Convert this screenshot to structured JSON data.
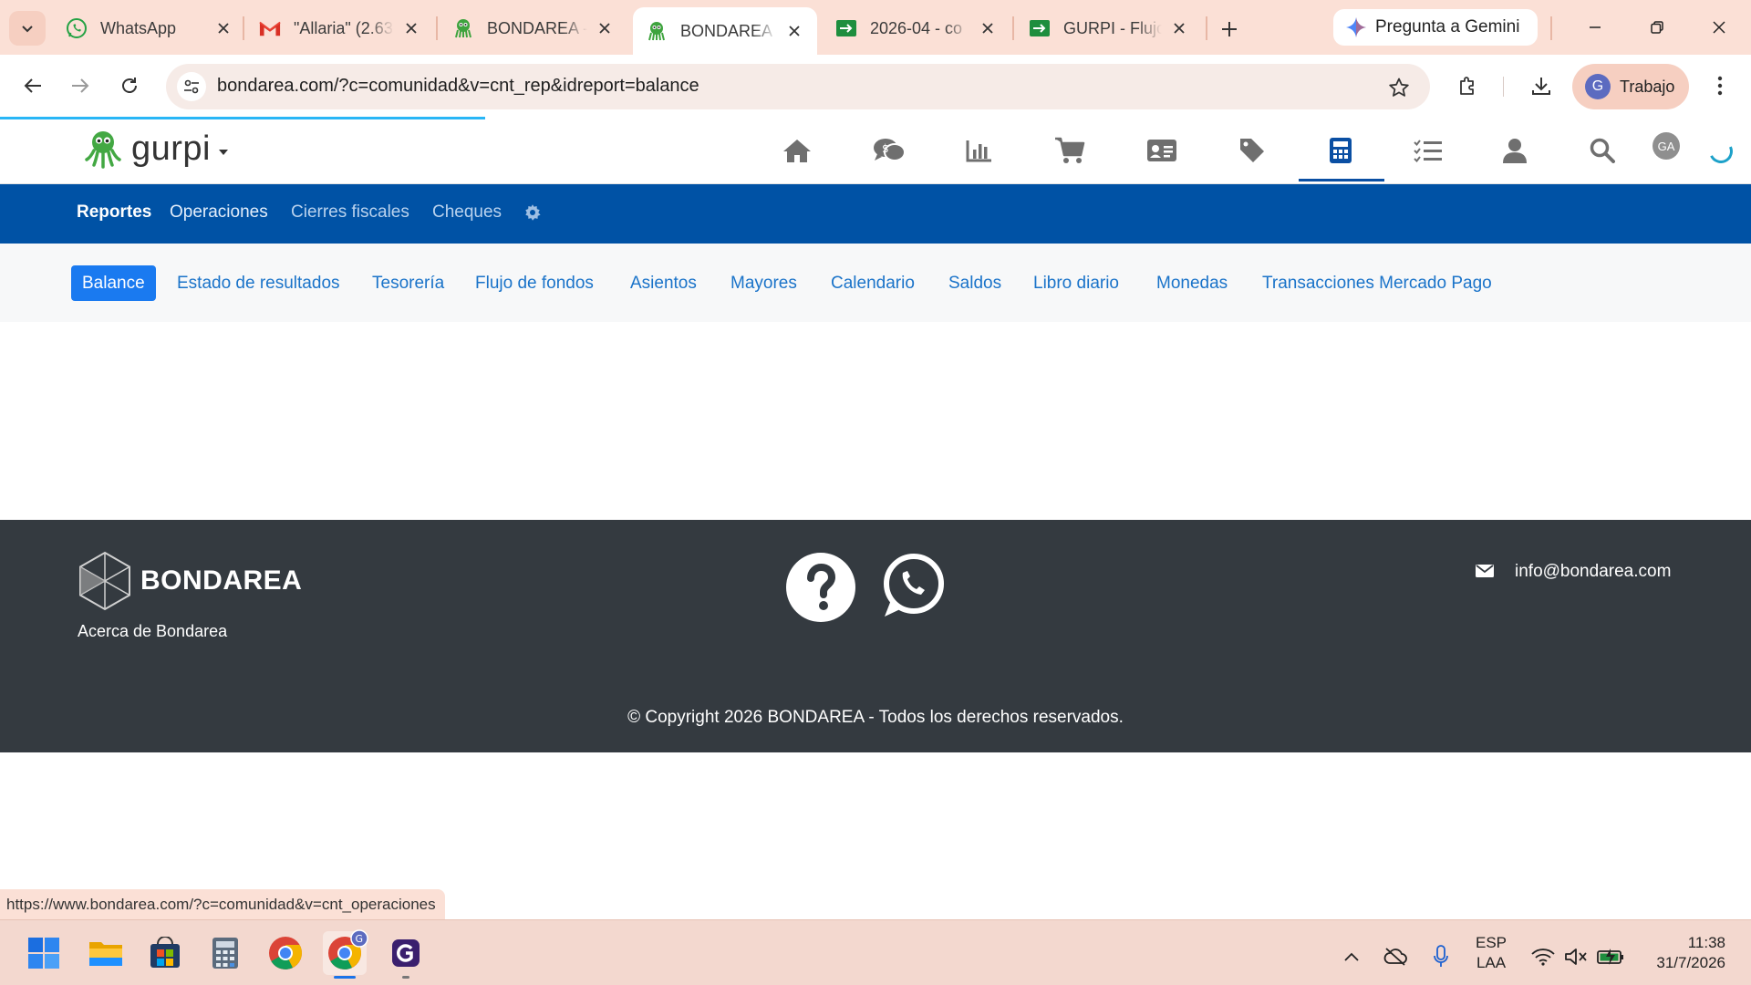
{
  "browser": {
    "tabs": [
      {
        "title": "WhatsApp",
        "icon": "whatsapp-icon",
        "active": false
      },
      {
        "title": "\"Allaria\" (2.63",
        "icon": "gmail-icon",
        "active": false
      },
      {
        "title": "BONDAREA -",
        "icon": "gurpi-octopus-icon",
        "active": false
      },
      {
        "title": "BONDAREA -",
        "icon": "gurpi-octopus-icon",
        "active": true
      },
      {
        "title": "2026-04 - co",
        "icon": "sheets-icon",
        "active": false
      },
      {
        "title": "GURPI - Flujo",
        "icon": "sheets-icon",
        "active": false
      }
    ],
    "gemini_label": "Pregunta a Gemini",
    "url": "bondarea.com/?c=comunidad&v=cnt_rep&idreport=balance",
    "profile_initial": "G",
    "profile_name": "Trabajo"
  },
  "app": {
    "brand": "gurpi",
    "header_icons": [
      "home-icon",
      "chat-money-icon",
      "bar-chart-icon",
      "cart-icon",
      "id-card-icon",
      "tag-icon",
      "calculator-icon",
      "checklist-icon",
      "user-icon",
      "search-icon"
    ],
    "active_header_icon": "calculator-icon",
    "user_initials": "GA",
    "module_nav": [
      "Reportes",
      "Operaciones",
      "Cierres fiscales",
      "Cheques"
    ],
    "active_module": "Reportes",
    "report_tabs": [
      "Balance",
      "Estado de resultados",
      "Tesorería",
      "Flujo de fondos",
      "Asientos",
      "Mayores",
      "Calendario",
      "Saldos",
      "Libro diario",
      "Monedas",
      "Transacciones Mercado Pago"
    ],
    "active_report": "Balance"
  },
  "footer": {
    "brand": "BONDAREA",
    "about": "Acerca de Bondarea",
    "email": "info@bondarea.com",
    "copyright": "© Copyright 2026 BONDAREA - Todos los derechos reservados."
  },
  "status_url": "https://www.bondarea.com/?c=comunidad&v=cnt_operaciones",
  "taskbar": {
    "apps": [
      "windows-start-icon",
      "file-explorer-icon",
      "ms-store-icon",
      "calculator-app-icon",
      "chrome-icon",
      "chrome-profile-icon",
      "app-g-icon"
    ],
    "language_top": "ESP",
    "language_bottom": "LAA",
    "time": "11:38",
    "date": "31/7/2026"
  },
  "colors": {
    "chrome_tab_strip": "#fbe0d6",
    "app_nav_blue": "#0052a5",
    "report_active": "#1a7af0",
    "footer_bg": "#343a40",
    "link": "#1a73c9"
  }
}
